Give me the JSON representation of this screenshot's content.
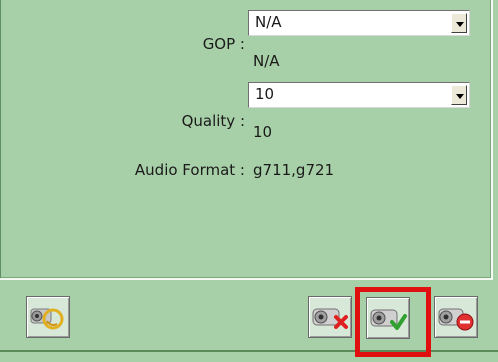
{
  "gop": {
    "label": "GOP :",
    "selected": "N/A",
    "current_value": "N/A"
  },
  "quality": {
    "label": "Quality :",
    "selected": "10",
    "current_value": "10"
  },
  "audio": {
    "label": "Audio Format :",
    "value": "g711,g721"
  },
  "buttons": {
    "left": "camera-refresh-icon",
    "cancel": "camera-cancel-icon",
    "apply": "camera-apply-icon",
    "delete": "camera-delete-icon"
  },
  "colors": {
    "panel_bg": "#a8d0a8",
    "highlight": "#e01010"
  }
}
